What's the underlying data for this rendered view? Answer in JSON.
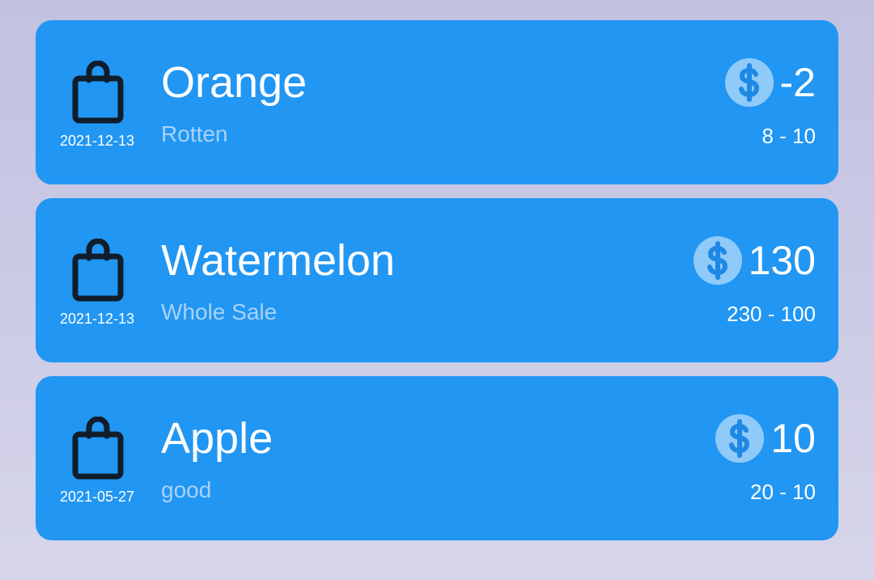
{
  "colors": {
    "card": "#2196f3",
    "icon_dark": "#111d2b",
    "dollar_circle": "#90caf9",
    "dollar_symbol": "#1e88e5",
    "note_text": "#a9d2f7"
  },
  "icons": {
    "bag": "shopping-bag-icon",
    "dollar": "dollar-circle-icon"
  },
  "transactions": [
    {
      "name": "Orange",
      "note": "Rotten",
      "date": "2021-12-13",
      "amount": "-2",
      "range": "8 - 10"
    },
    {
      "name": "Watermelon",
      "note": "Whole Sale",
      "date": "2021-12-13",
      "amount": "130",
      "range": "230 - 100"
    },
    {
      "name": "Apple",
      "note": "good",
      "date": "2021-05-27",
      "amount": "10",
      "range": "20 - 10"
    }
  ]
}
